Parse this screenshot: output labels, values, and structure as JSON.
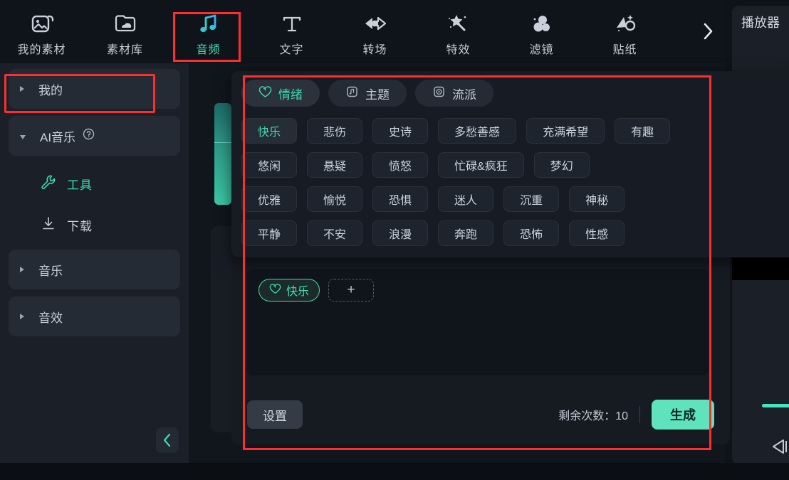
{
  "toolbar": {
    "items": [
      {
        "label": "我的素材",
        "icon": "image-icon",
        "active": false
      },
      {
        "label": "素材库",
        "icon": "cloud-folder-icon",
        "active": false
      },
      {
        "label": "音频",
        "icon": "music-note-icon",
        "active": true
      },
      {
        "label": "文字",
        "icon": "text-T-icon",
        "active": false
      },
      {
        "label": "转场",
        "icon": "transition-arrows-icon",
        "active": false
      },
      {
        "label": "特效",
        "icon": "magic-wand-icon",
        "active": false
      },
      {
        "label": "滤镜",
        "icon": "filter-circles-icon",
        "active": false
      },
      {
        "label": "贴纸",
        "icon": "sticker-icon",
        "active": false
      }
    ],
    "next_label": "›"
  },
  "sidebar": {
    "groups": [
      {
        "label": "我的",
        "expanded": false
      },
      {
        "label": "AI音乐",
        "expanded": true,
        "help": "?"
      },
      {
        "label": "音乐",
        "expanded": false
      },
      {
        "label": "音效",
        "expanded": false
      }
    ],
    "ai_music_children": [
      {
        "label": "工具",
        "icon": "wrench-icon",
        "active": true
      },
      {
        "label": "下载",
        "icon": "download-icon",
        "active": false
      }
    ],
    "collapse_label": "‹"
  },
  "dropdown": {
    "tabs": [
      {
        "label": "情绪",
        "icon": "heart-icon",
        "active": true
      },
      {
        "label": "主题",
        "icon": "theme-box-icon",
        "active": false
      },
      {
        "label": "流派",
        "icon": "genre-disc-icon",
        "active": false
      }
    ],
    "rows": [
      [
        {
          "label": "快乐",
          "active": true
        },
        {
          "label": "悲伤",
          "active": false
        },
        {
          "label": "史诗",
          "active": false
        },
        {
          "label": "多愁善感",
          "active": false
        },
        {
          "label": "充满希望",
          "active": false
        },
        {
          "label": "有趣",
          "active": false
        }
      ],
      [
        {
          "label": "悠闲",
          "active": false
        },
        {
          "label": "悬疑",
          "active": false
        },
        {
          "label": "愤怒",
          "active": false
        },
        {
          "label": "忙碌&疯狂",
          "active": false
        },
        {
          "label": "梦幻",
          "active": false
        }
      ],
      [
        {
          "label": "优雅",
          "active": false
        },
        {
          "label": "愉悦",
          "active": false
        },
        {
          "label": "恐惧",
          "active": false
        },
        {
          "label": "迷人",
          "active": false
        },
        {
          "label": "沉重",
          "active": false
        },
        {
          "label": "神秘",
          "active": false
        }
      ],
      [
        {
          "label": "平静",
          "active": false
        },
        {
          "label": "不安",
          "active": false
        },
        {
          "label": "浪漫",
          "active": false
        },
        {
          "label": "奔跑",
          "active": false
        },
        {
          "label": "恐怖",
          "active": false
        },
        {
          "label": "性感",
          "active": false
        }
      ]
    ]
  },
  "panel": {
    "selected_chip": {
      "label": "快乐",
      "icon": "heart-icon"
    },
    "add_chip_label": "+",
    "settings_label": "设置",
    "remaining_label": "剩余次数：10",
    "generate_label": "生成"
  },
  "player": {
    "title": "播放器",
    "prev_frame_icon": "prev-frame-icon"
  },
  "colors": {
    "accent": "#3ddbb0",
    "generate_bg": "#5fe3bd",
    "annotation": "#ff2d2d",
    "panel_bg": "#161b22"
  }
}
